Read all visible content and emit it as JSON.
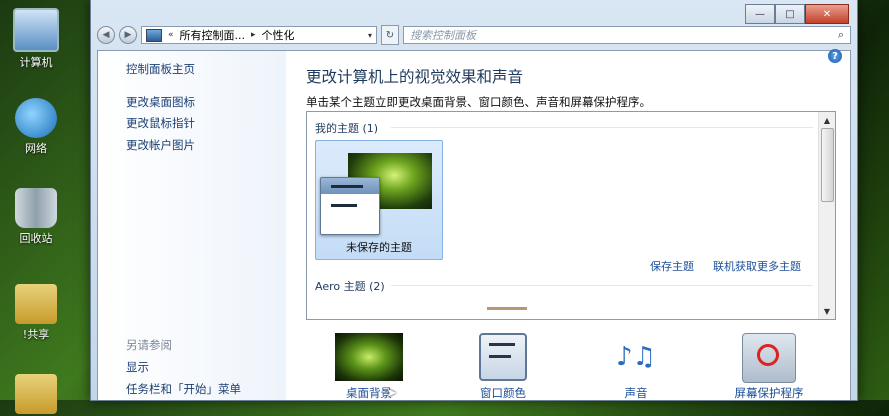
{
  "desktop": {
    "icons": [
      {
        "label": "计算机"
      },
      {
        "label": "网络"
      },
      {
        "label": "回收站"
      },
      {
        "label": "!共享"
      }
    ]
  },
  "window": {
    "caption": {
      "minimize": "—",
      "maximize": "□",
      "close": "✕"
    },
    "address": {
      "prefix": "«",
      "crumb1": "所有控制面...",
      "sep": "▸",
      "crumb2": "个性化",
      "dropdown": "▾"
    },
    "refresh": "↻",
    "search_placeholder": "搜索控制面板",
    "search_icon": "⌕",
    "help_label": "?",
    "left_pane": {
      "home": "控制面板主页",
      "links": [
        "更改桌面图标",
        "更改鼠标指针",
        "更改帐户图片"
      ],
      "see_also_heading": "另请参阅",
      "see_also": [
        "显示",
        "任务栏和「开始」菜单"
      ]
    },
    "main": {
      "title": "更改计算机上的视觉效果和声音",
      "subtitle": "单击某个主题立即更改桌面背景、窗口颜色、声音和屏幕保护程序。",
      "my_themes_label": "我的主题 (1)",
      "unsaved_theme": "未保存的主题",
      "save_theme": "保存主题",
      "get_more_themes": "联机获取更多主题",
      "aero_label": "Aero 主题 (2)",
      "scroll_up": "▲",
      "scroll_down": "▼"
    },
    "bottom": [
      {
        "label": "桌面背景"
      },
      {
        "label": "窗口颜色"
      },
      {
        "label": "声音"
      },
      {
        "label": "屏幕保护程序"
      }
    ],
    "sound_glyph": "♪♫"
  }
}
